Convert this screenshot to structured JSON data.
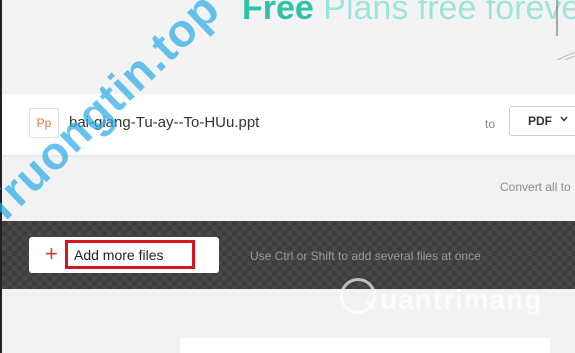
{
  "hero": {
    "free_word": "Free",
    "rest_text": "Plans free forever"
  },
  "file": {
    "icon_text": "Pp",
    "name": "bai-giang-Tu-ay--To-HUu.ppt",
    "to_label": "to",
    "format_value": "PDF"
  },
  "convert_all": "Convert all to",
  "dropzone": {
    "add_button_label": "Add more files",
    "hint": "Use Ctrl or Shift to add several files at once"
  },
  "watermark": {
    "diagonal": "Truongtin.top",
    "brand": "uantrimang"
  },
  "colors": {
    "accent": "#2fc2a8",
    "highlight": "#d8141c",
    "plus": "#d0392b",
    "dropzone_bg": "#3d3d3d"
  }
}
